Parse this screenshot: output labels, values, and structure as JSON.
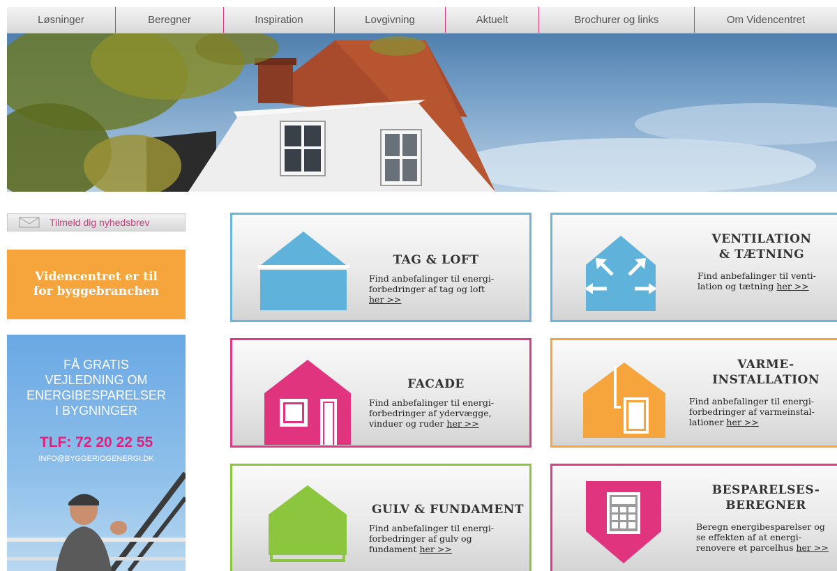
{
  "nav": {
    "items": [
      {
        "label": "Løsninger"
      },
      {
        "label": "Beregner"
      },
      {
        "label": "Inspiration"
      },
      {
        "label": "Lovgivning"
      },
      {
        "label": "Aktuelt"
      },
      {
        "label": "Brochurer og links"
      },
      {
        "label": "Om Videncentret"
      }
    ]
  },
  "sidebar": {
    "newsletter_label": "Tilmeld dig nyhedsbrev",
    "promo_line1": "Videncentret er til",
    "promo_line2": "for byggebranchen",
    "ad": {
      "line1": "FÅ GRATIS",
      "line2": "VEJLEDNING OM",
      "line3": "ENERGIBESPARELSER",
      "line4": "I BYGNINGER",
      "phone": "TLF: 72 20 22 55",
      "email": "INFO@BYGGERIOGENERGI.DK"
    }
  },
  "cards": {
    "tag": {
      "title": "TAG & LOFT",
      "desc1": "Find anbefalinger til energi-",
      "desc2": "forbedringer af tag og loft",
      "link": "her >>"
    },
    "ventilation": {
      "title1": "VENTILATION",
      "title2": "& TÆTNING",
      "desc1": "Find anbefalinger til venti-",
      "desc2": "lation og tætning",
      "link": "her >>"
    },
    "facade": {
      "title": "FACADE",
      "desc1": "Find anbefalinger til energi-",
      "desc2": "forbedringer af ydervægge,",
      "desc3": "vinduer og ruder",
      "link": "her >>"
    },
    "varme": {
      "title1": "VARME-",
      "title2": "INSTALLATION",
      "desc1": "Find anbefalinger til energi-",
      "desc2": "forbedringer af varmeinstal-",
      "desc3": "lationer",
      "link": "her >>"
    },
    "gulv": {
      "title": "GULV & FUNDAMENT",
      "desc1": "Find anbefalinger til energi-",
      "desc2": "forbedringer af gulv og",
      "desc3": "fundament",
      "link": "her >>"
    },
    "besparelse": {
      "title1": "BESPARELSES-",
      "title2": "BEREGNER",
      "desc1": "Beregn energibesparelser og",
      "desc2": "se effekten af at energi-",
      "desc3": "renovere et parcelhus",
      "link": "her >>"
    }
  },
  "colors": {
    "blue": "#6ab6dc",
    "pink": "#e03a8a",
    "orange": "#f6a43c",
    "green": "#8cc63f"
  }
}
